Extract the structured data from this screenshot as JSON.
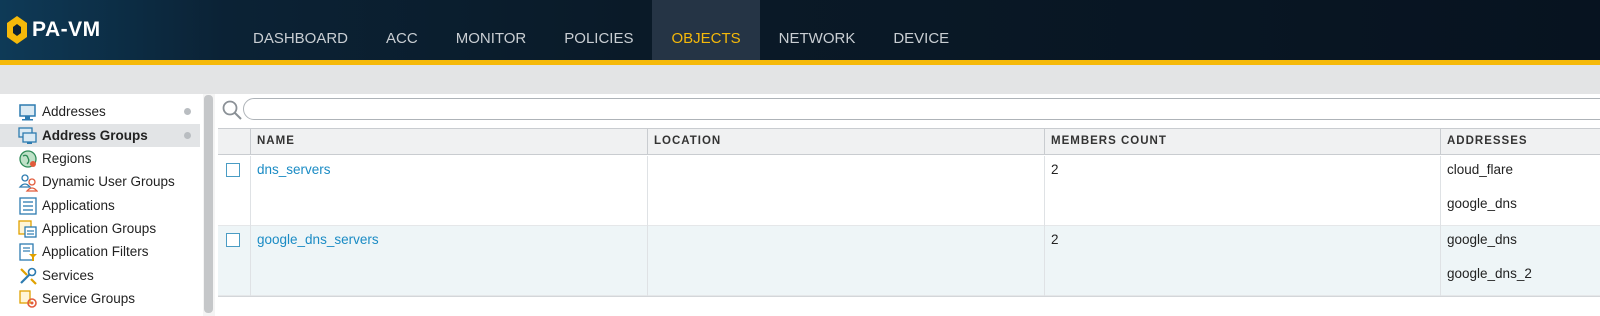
{
  "app": {
    "title": "PA-VM"
  },
  "nav": [
    {
      "label": "DASHBOARD",
      "active": false
    },
    {
      "label": "ACC",
      "active": false
    },
    {
      "label": "MONITOR",
      "active": false
    },
    {
      "label": "POLICIES",
      "active": false
    },
    {
      "label": "OBJECTS",
      "active": true
    },
    {
      "label": "NETWORK",
      "active": false
    },
    {
      "label": "DEVICE",
      "active": false
    }
  ],
  "sidebar": {
    "items": [
      {
        "label": "Addresses",
        "icon": "addresses-icon",
        "active": false,
        "dot": true
      },
      {
        "label": "Address Groups",
        "icon": "address-groups-icon",
        "active": true,
        "dot": true
      },
      {
        "label": "Regions",
        "icon": "regions-globe-icon",
        "active": false,
        "dot": false
      },
      {
        "label": "Dynamic User Groups",
        "icon": "dynamic-user-groups-icon",
        "active": false,
        "dot": false
      },
      {
        "label": "Applications",
        "icon": "applications-icon",
        "active": false,
        "dot": false
      },
      {
        "label": "Application Groups",
        "icon": "application-groups-icon",
        "active": false,
        "dot": false
      },
      {
        "label": "Application Filters",
        "icon": "application-filters-icon",
        "active": false,
        "dot": false
      },
      {
        "label": "Services",
        "icon": "services-icon",
        "active": false,
        "dot": false
      },
      {
        "label": "Service Groups",
        "icon": "service-groups-icon",
        "active": false,
        "dot": false
      }
    ]
  },
  "search": {
    "value": "",
    "placeholder": ""
  },
  "table": {
    "columns": [
      "NAME",
      "LOCATION",
      "MEMBERS COUNT",
      "ADDRESSES"
    ],
    "rows": [
      {
        "name": "dns_servers",
        "location": "",
        "members_count": "2",
        "addresses": [
          "cloud_flare",
          "google_dns"
        ]
      },
      {
        "name": "google_dns_servers",
        "location": "",
        "members_count": "2",
        "addresses": [
          "google_dns",
          "google_dns_2"
        ]
      }
    ]
  },
  "colors": {
    "accent": "#f5b90a",
    "header_bg": "#0a1a28",
    "link": "#1a8bc4"
  }
}
